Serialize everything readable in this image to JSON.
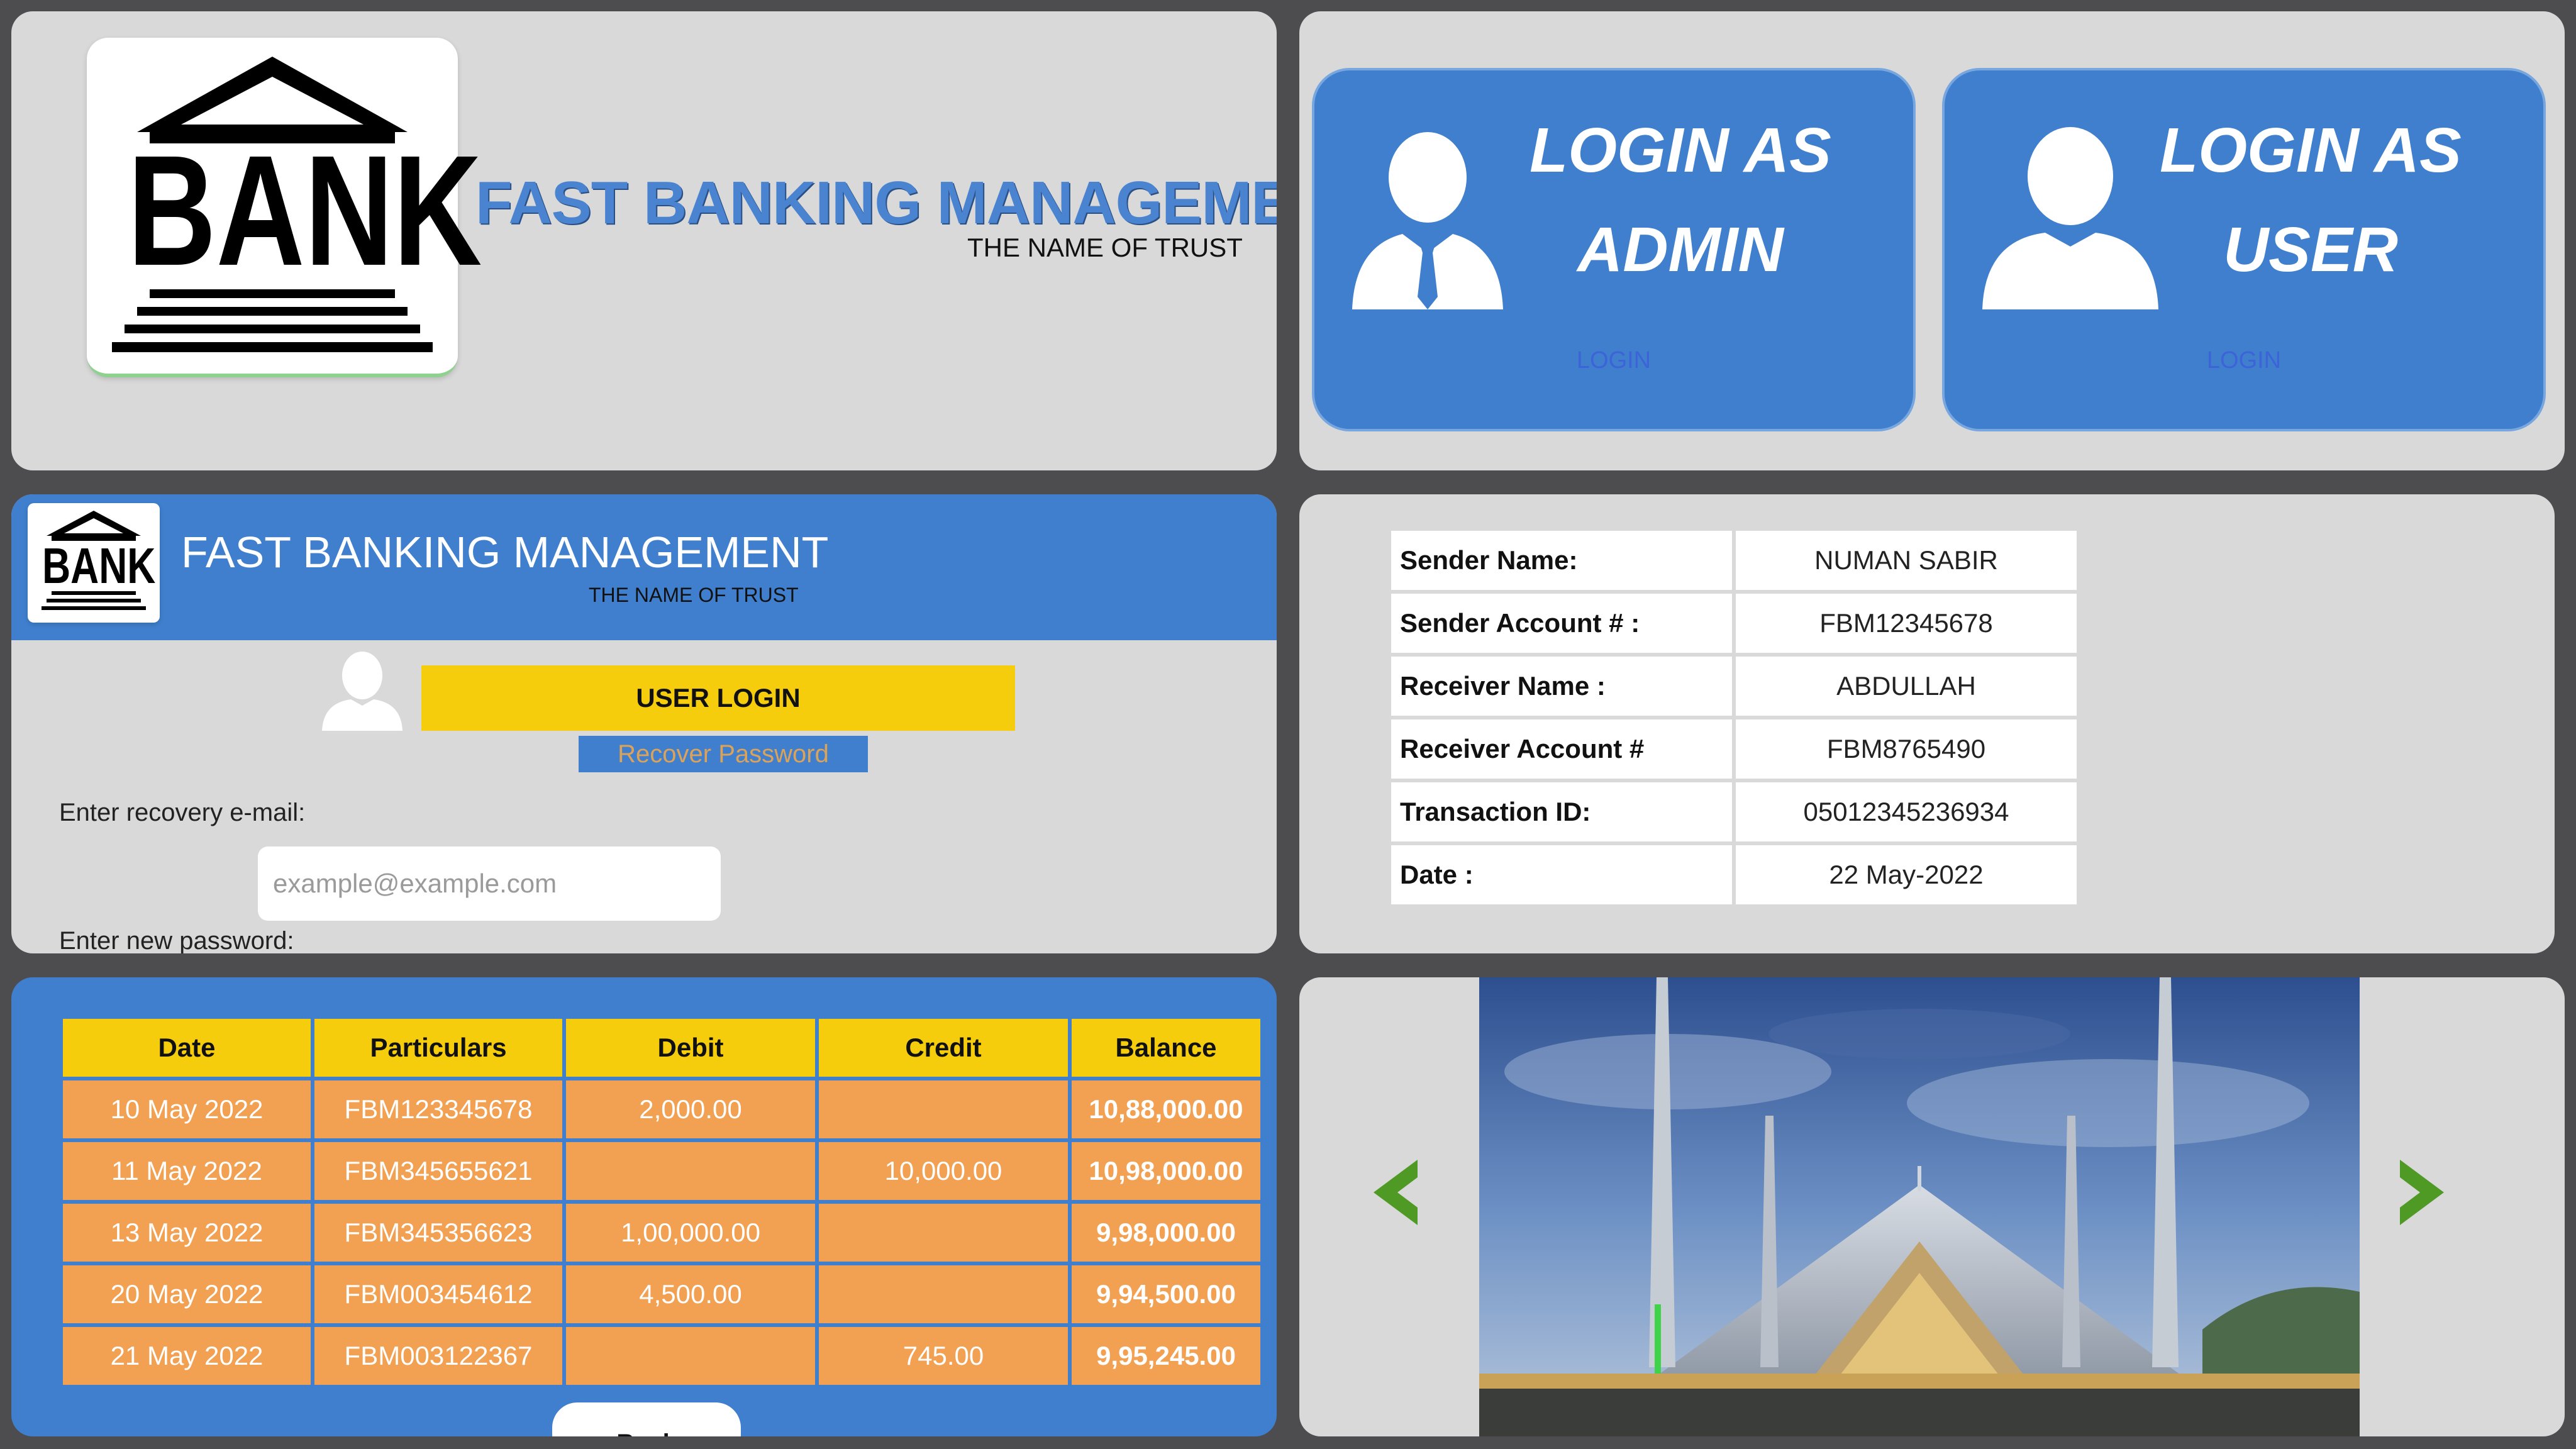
{
  "brand": {
    "logo_text": "BANK",
    "title": "FAST BANKING MANAGEMENT",
    "tagline": "THE NAME OF TRUST"
  },
  "login_options": [
    {
      "title_line1": "LOGIN AS",
      "title_line2": "ADMIN",
      "link": "LOGIN",
      "icon": "admin-user-icon"
    },
    {
      "title_line1": "LOGIN AS",
      "title_line2": "USER",
      "link": "LOGIN",
      "icon": "user-icon"
    }
  ],
  "recovery": {
    "title": "FAST BANKING MANAGEMENT",
    "tagline": "THE NAME OF TRUST",
    "user_login_label": "USER LOGIN",
    "recover_label": "Recover Password",
    "email_label": "Enter recovery e-mail:",
    "email_placeholder": "example@example.com",
    "password_label": "Enter new password:"
  },
  "transaction": {
    "rows": [
      {
        "key": "Sender Name:",
        "value": "NUMAN SABIR"
      },
      {
        "key": "Sender Account # :",
        "value": "FBM12345678"
      },
      {
        "key": "Receiver Name :",
        "value": "ABDULLAH"
      },
      {
        "key": "Receiver Account #",
        "value": "FBM8765490"
      },
      {
        "key": "Transaction ID:",
        "value": "05012345236934"
      },
      {
        "key": "Date :",
        "value": "22 May-2022"
      }
    ]
  },
  "statement": {
    "headers": [
      "Date",
      "Particulars",
      "Debit",
      "Credit",
      "Balance"
    ],
    "rows": [
      {
        "date": "10 May 2022",
        "particulars": "FBM123345678",
        "debit": "2,000.00",
        "credit": "",
        "balance": "10,88,000.00"
      },
      {
        "date": "11 May 2022",
        "particulars": "FBM345655621",
        "debit": "",
        "credit": "10,000.00",
        "balance": "10,98,000.00"
      },
      {
        "date": "13 May 2022",
        "particulars": "FBM345356623",
        "debit": "1,00,000.00",
        "credit": "",
        "balance": "9,98,000.00"
      },
      {
        "date": "20 May 2022",
        "particulars": "FBM003454612",
        "debit": "4,500.00",
        "credit": "",
        "balance": "9,94,500.00"
      },
      {
        "date": "21 May 2022",
        "particulars": "FBM003122367",
        "debit": "",
        "credit": "745.00",
        "balance": "9,95,245.00"
      }
    ],
    "back_label": "Back"
  },
  "gallery": {
    "prev_icon": "chevron-left-icon",
    "next_icon": "chevron-right-icon",
    "image": "mosque-photo"
  },
  "colors": {
    "accent_blue": "#3f7fcd",
    "yellow": "#f6cd0c",
    "orange": "#f2a052",
    "panel_bg": "#d9d9d9",
    "arrow_green": "#4f9a24"
  }
}
